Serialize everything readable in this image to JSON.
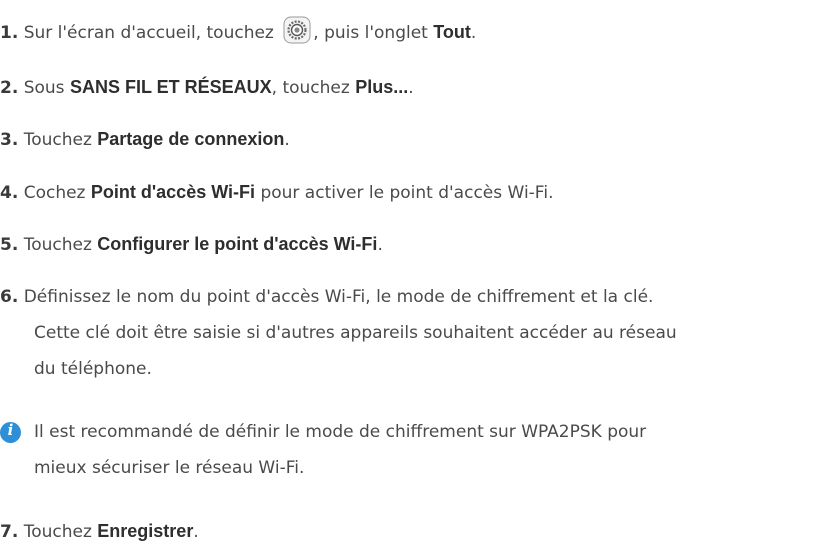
{
  "steps": [
    {
      "num": "1.",
      "parts": [
        "Sur l'écran d'accueil, touchez ",
        ", puis l'onglet ",
        "Tout",
        "."
      ]
    },
    {
      "num": "2.",
      "parts": [
        "Sous ",
        "SANS FIL ET RÉSEAUX",
        ", touchez ",
        "Plus...",
        "."
      ]
    },
    {
      "num": "3.",
      "parts": [
        "Touchez ",
        "Partage de connexion",
        "."
      ]
    },
    {
      "num": "4.",
      "parts": [
        "Cochez ",
        "Point d'accès Wi-Fi",
        " pour activer le point d'accès Wi-Fi."
      ]
    },
    {
      "num": "5.",
      "parts": [
        "Touchez ",
        "Configurer le point d'accès Wi-Fi",
        "."
      ]
    },
    {
      "num": "6.",
      "lines": [
        "Définissez le nom du point d'accès Wi-Fi, le mode de chiffrement et la clé.",
        "Cette clé doit être saisie si d'autres appareils souhaitent accéder au réseau",
        "du téléphone."
      ]
    },
    {
      "num": "7.",
      "parts": [
        "Touchez ",
        "Enregistrer",
        "."
      ]
    }
  ],
  "note": {
    "icon": "info-icon",
    "glyph": "i",
    "lines": [
      "Il est recommandé de définir le mode de chiffrement sur WPA2PSK pour",
      "mieux sécuriser le réseau Wi-Fi."
    ]
  },
  "icons": {
    "settings": "settings-app-icon"
  },
  "colors": {
    "text": "#4a4a4a",
    "bold": "#2e2e2e",
    "info": "#2f8fd6"
  }
}
